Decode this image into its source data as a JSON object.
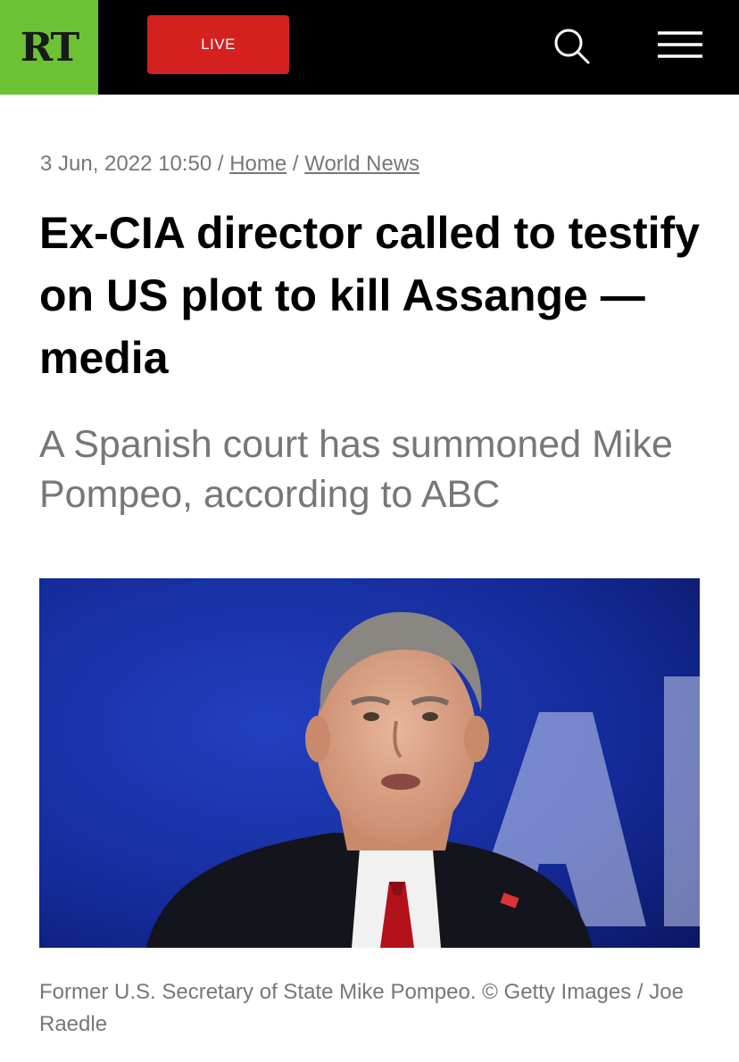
{
  "header": {
    "logo_text": "RT",
    "live_label": "LIVE",
    "search_icon": "search-icon",
    "menu_icon": "hamburger-menu-icon",
    "colors": {
      "background": "#000000",
      "logo_background": "#6cc233",
      "live_background": "#d52020"
    }
  },
  "article": {
    "date": "3 Jun, 2022 10:50",
    "separator": "/",
    "breadcrumbs": [
      {
        "label": "Home"
      },
      {
        "label": "World News"
      }
    ],
    "headline": "Ex-CIA director called to testify on US plot to kill Assange — media",
    "subheadline": "A Spanish court has summoned Mike Pompeo, according to ABC",
    "caption": "Former U.S. Secretary of State Mike Pompeo. © Getty Images / Joe Raedle"
  }
}
